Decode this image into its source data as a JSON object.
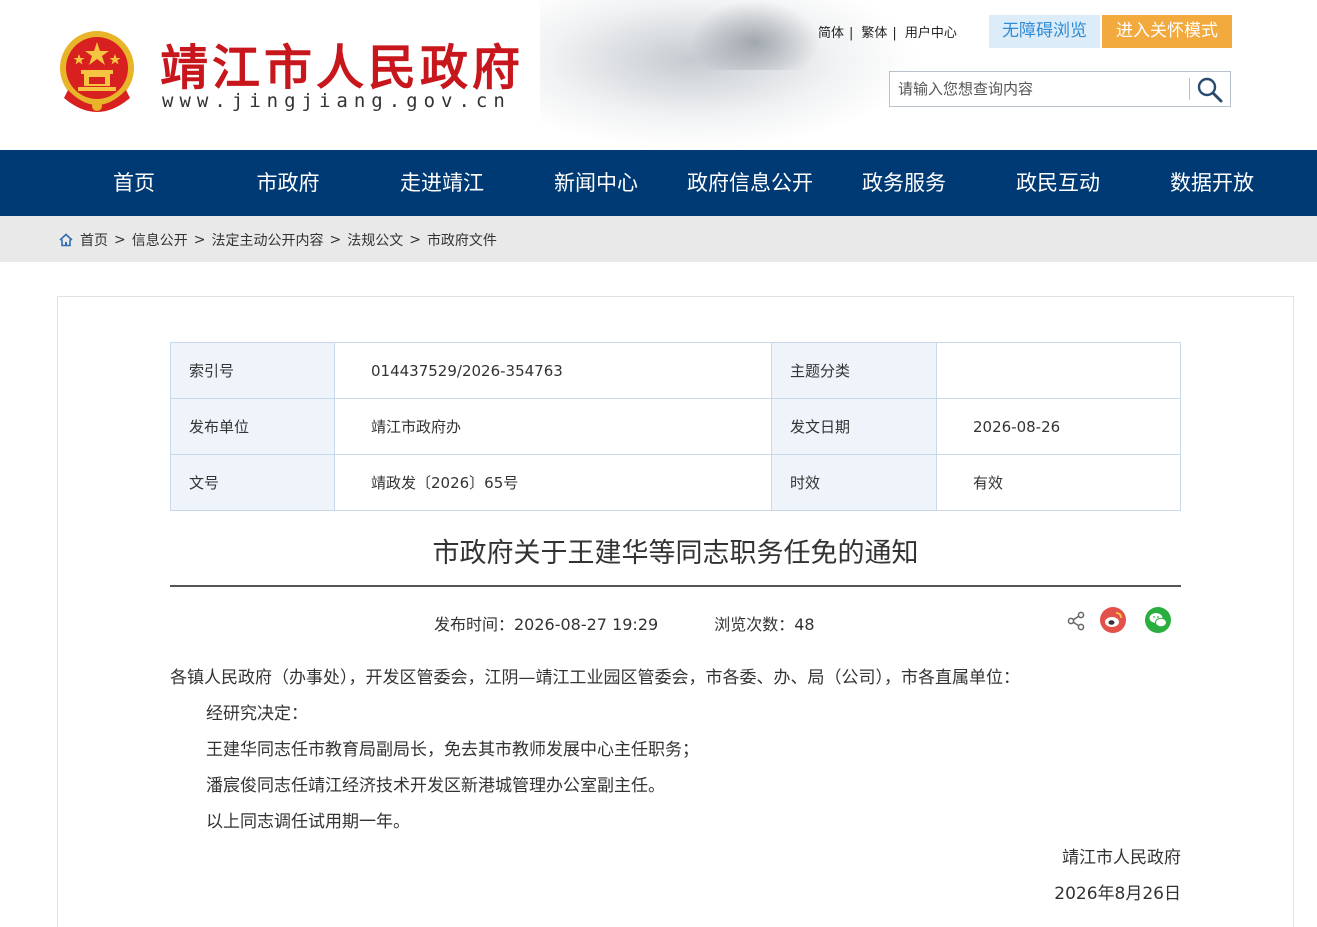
{
  "header": {
    "site_name": "靖江市人民政府",
    "site_url": "www.jingjiang.gov.cn",
    "links": [
      "简体",
      "繁体",
      "用户中心"
    ],
    "accessibility_label": "无障碍浏览",
    "care_mode_label": "进入关怀模式",
    "search_placeholder": "请输入您想查询内容"
  },
  "nav": [
    "首页",
    "市政府",
    "走进靖江",
    "新闻中心",
    "政府信息公开",
    "政务服务",
    "政民互动",
    "数据开放"
  ],
  "breadcrumb": [
    "首页",
    "信息公开",
    "法定主动公开内容",
    "法规公文",
    "市政府文件"
  ],
  "meta": {
    "index_no_label": "索引号",
    "index_no": "014437529/2026-354763",
    "topic_label": "主题分类",
    "topic": "",
    "publisher_label": "发布单位",
    "publisher": "靖江市政府办",
    "date_label": "发文日期",
    "date": "2026-08-26",
    "doc_no_label": "文号",
    "doc_no": "靖政发〔2026〕65号",
    "validity_label": "时效",
    "validity": "有效"
  },
  "article": {
    "title": "市政府关于王建华等同志职务任免的通知",
    "publish_time": "发布时间：2026-08-27 19:29",
    "views": "浏览次数：48",
    "recipients": "各镇人民政府（办事处），开发区管委会，江阴—靖江工业园区管委会，市各委、办、局（公司），市各直属单位：",
    "paragraphs": [
      "经研究决定：",
      "王建华同志任市教育局副局长，免去其市教师发展中心主任职务；",
      "潘宸俊同志任靖江经济技术开发区新港城管理办公室副主任。",
      "以上同志调任试用期一年。"
    ],
    "signature": "靖江市人民政府",
    "sign_date": "2026年8月26日"
  },
  "colors": {
    "nav_bg": "#003a74",
    "brand_red": "#c8161d",
    "care_orange": "#f2a93d",
    "access_blue": "#2e8bd6"
  }
}
